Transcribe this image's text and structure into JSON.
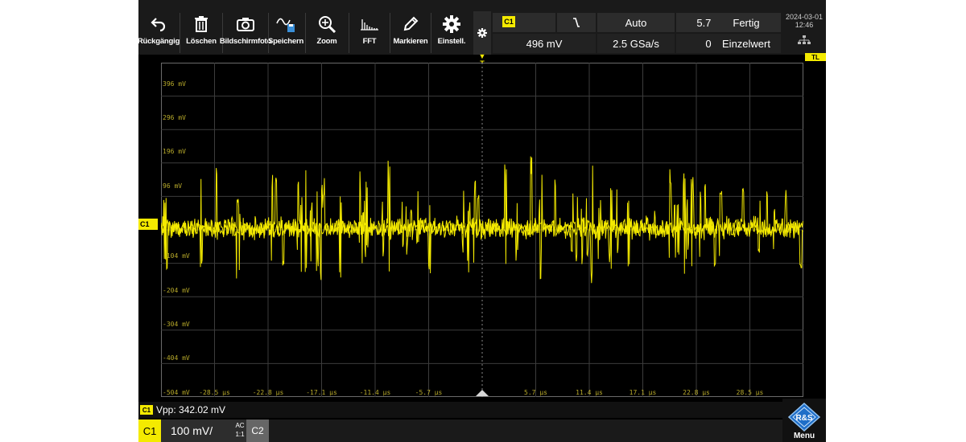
{
  "toolbar": {
    "buttons": [
      {
        "label": "Rückgängig",
        "icon": "undo-icon"
      },
      {
        "label": "Löschen",
        "icon": "trash-icon"
      },
      {
        "label": "Bildschirmfoto",
        "icon": "camera-icon"
      },
      {
        "label": "Speichern",
        "icon": "save-icon"
      },
      {
        "label": "Zoom",
        "icon": "zoom-icon"
      },
      {
        "label": "FFT",
        "icon": "fft-icon"
      },
      {
        "label": "Markieren",
        "icon": "pen-icon"
      },
      {
        "label": "Einstell.",
        "icon": "gear-icon"
      }
    ]
  },
  "status": {
    "channel_tag": "C1",
    "trigger_level": "496 mV",
    "trigger_mode": "Auto",
    "sample_rate": "2.5 GSa/s",
    "time_div": "5.7 µs/",
    "time_offset": "0 s",
    "acq_state": "Fertig",
    "acq_mode": "Einzelwert",
    "date": "2024-03-01",
    "time": "12:46"
  },
  "markers": {
    "channel": "C1",
    "trigger_label": "TL",
    "trigger_pos": "T"
  },
  "plot": {
    "y_labels": [
      "396 mV",
      "296 mV",
      "196 mV",
      "96 mV",
      "-104 mV",
      "-204 mV",
      "-304 mV",
      "-404 mV",
      "-504 mV"
    ],
    "x_labels": [
      "-28.5 µs",
      "-22.8 µs",
      "-17.1 µs",
      "-11.4 µs",
      "-5.7 µs",
      "5.7 µs",
      "11.4 µs",
      "17.1 µs",
      "22.8 µs",
      "28.5 µs"
    ],
    "trace_color": "#f4ea00"
  },
  "measurement": {
    "tag": "C1",
    "text": "Vpp: 342.02 mV"
  },
  "channels": {
    "c1_label": "C1",
    "c1_scale": "100 mV/",
    "coupling": "AC",
    "probe": "1:1",
    "c2_label": "C2"
  },
  "menu": {
    "label": "Menu",
    "logo_text": "R&S"
  }
}
